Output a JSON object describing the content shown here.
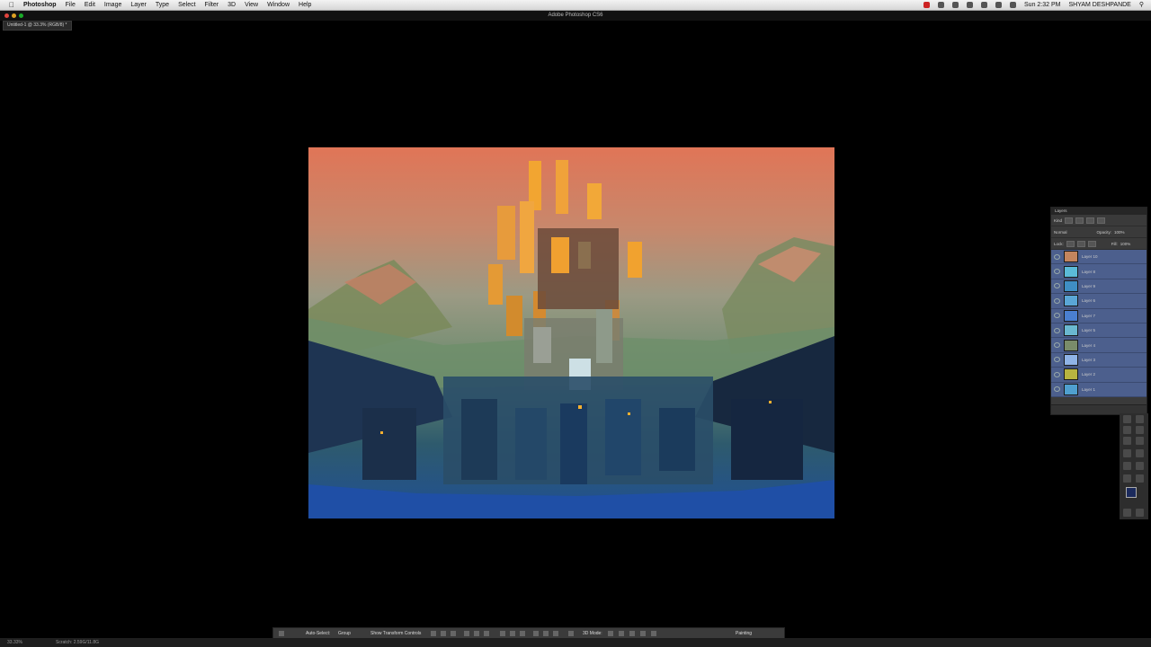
{
  "menubar": {
    "app_name": "Photoshop",
    "menus": [
      "File",
      "Edit",
      "Image",
      "Layer",
      "Type",
      "Select",
      "Filter",
      "3D",
      "View",
      "Window",
      "Help"
    ],
    "clock": "Sun 2:32 PM",
    "user": "SHYAM DESHPANDE"
  },
  "window": {
    "title": "Adobe Photoshop CS6"
  },
  "document": {
    "tab_label": "Untitled-1 @ 33.3% (RGB/8) *"
  },
  "layers_panel": {
    "title": "Layers",
    "filter_kind": "Kind",
    "blend_mode": "Normal",
    "opacity_label": "Opacity:",
    "opacity_value": "100%",
    "lock_label": "Lock:",
    "fill_label": "Fill:",
    "fill_value": "100%",
    "layers": [
      {
        "name": "Layer 10",
        "thumb": "#c4855e"
      },
      {
        "name": "Layer 8",
        "thumb": "#5bbbd8"
      },
      {
        "name": "Layer 9",
        "thumb": "#3f8ec3"
      },
      {
        "name": "Layer 6",
        "thumb": "#5aa6d6"
      },
      {
        "name": "Layer 7",
        "thumb": "#4a7fd0"
      },
      {
        "name": "Layer 5",
        "thumb": "#6ab8d0"
      },
      {
        "name": "Layer 4",
        "thumb": "#7a8c6a"
      },
      {
        "name": "Layer 3",
        "thumb": "#8fb3e6"
      },
      {
        "name": "Layer 2",
        "thumb": "#b7b440"
      },
      {
        "name": "Layer 1",
        "thumb": "#4f9fcf"
      }
    ]
  },
  "tools_panel": {
    "foreground_color": "#1b2a5c",
    "background_color": "#ffffff"
  },
  "options_bar": {
    "auto_select_label": "Auto-Select:",
    "auto_select_value": "Group",
    "transform_controls_label": "Show Transform Controls",
    "mode_3d_label": "3D Mode:",
    "workspace": "Painting"
  },
  "status_bar": {
    "zoom": "33.33%",
    "scratch": "Scratch: 2.59G/11.8G"
  }
}
